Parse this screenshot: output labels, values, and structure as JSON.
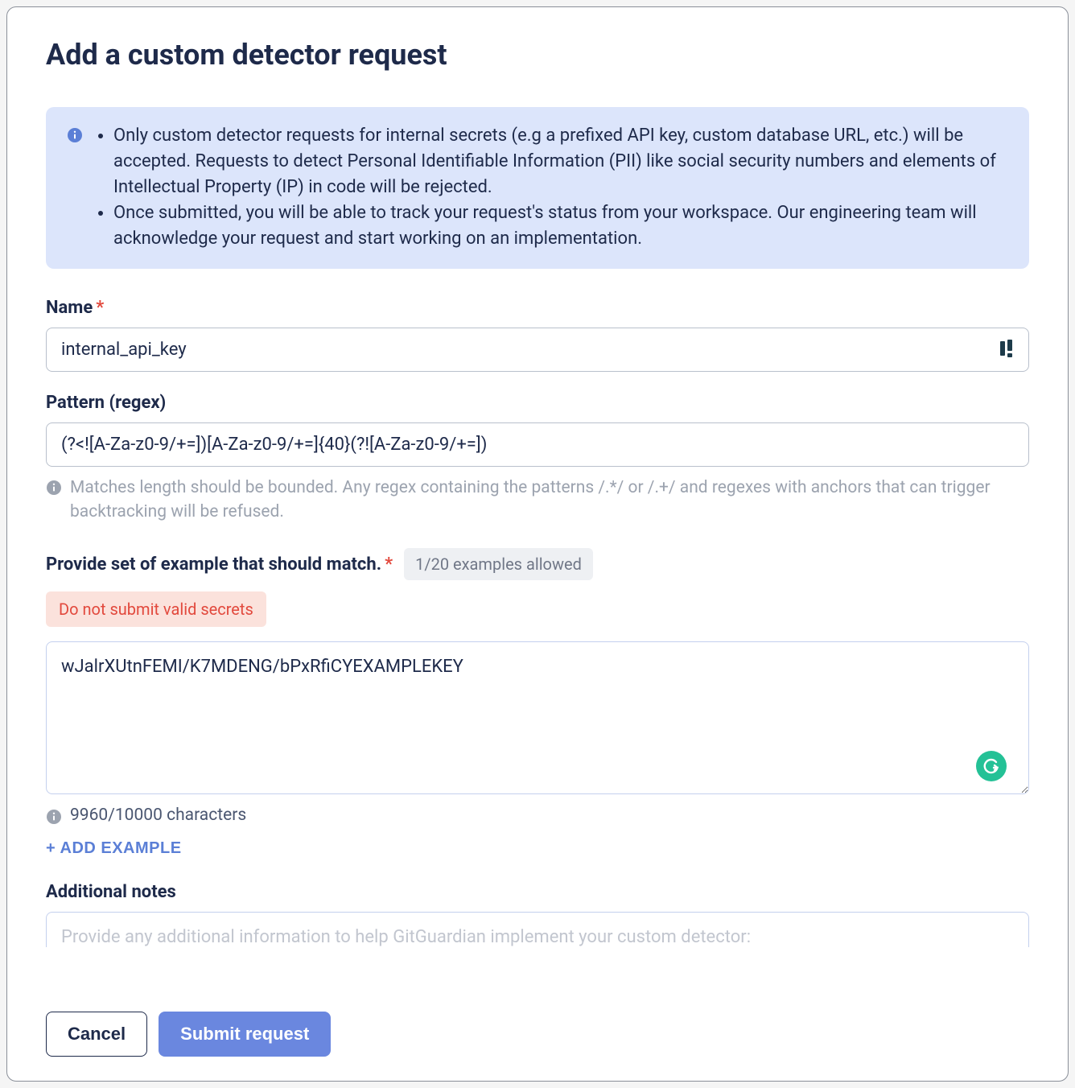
{
  "title": "Add a custom detector request",
  "info": {
    "bullet1": "Only custom detector requests for internal secrets (e.g a prefixed API key, custom database URL, etc.) will be accepted. Requests to detect Personal Identifiable Information (PII) like social security numbers and elements of Intellectual Property (IP) in code will be rejected.",
    "bullet2": "Once submitted, you will be able to track your request's status from your workspace. Our engineering team will acknowledge your request and start working on an implementation."
  },
  "name": {
    "label": "Name",
    "value": "internal_api_key"
  },
  "pattern": {
    "label": "Pattern (regex)",
    "value": "(?<![A-Za-z0-9/+=])[A-Za-z0-9/+=]{40}(?![A-Za-z0-9/+=])",
    "hint": "Matches length should be bounded. Any regex containing the patterns /.*/ or /.+/ and regexes with anchors that can trigger backtracking will be refused."
  },
  "examples": {
    "label": "Provide set of example that should match.",
    "count_badge": "1/20 examples allowed",
    "warning": "Do not submit valid secrets",
    "value": "wJalrXUtnFEMI/K7MDENG/bPxRfiCYEXAMPLEKEY",
    "char_count": "9960/10000 characters",
    "add_button": "+ ADD EXAMPLE"
  },
  "notes": {
    "label": "Additional notes",
    "placeholder": "Provide any additional information to help GitGuardian implement your custom detector:"
  },
  "footer": {
    "cancel": "Cancel",
    "submit": "Submit request"
  }
}
